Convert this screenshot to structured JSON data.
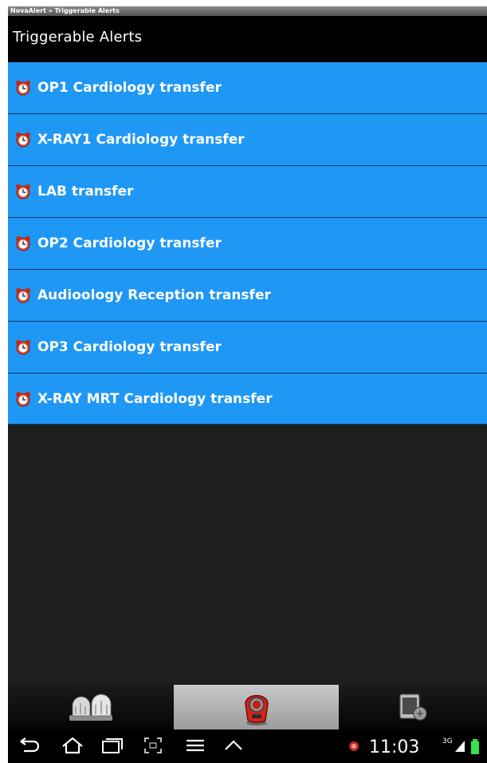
{
  "header": {
    "breadcrumb": "NovaAlert » Triggerable Alerts",
    "title": "Triggerable Alerts"
  },
  "alerts": [
    {
      "label": "OP1 Cardiology transfer",
      "icon": "alarm-clock-icon"
    },
    {
      "label": "X-RAY1 Cardiology transfer",
      "icon": "alarm-clock-icon"
    },
    {
      "label": "LAB transfer",
      "icon": "alarm-clock-icon"
    },
    {
      "label": "OP2 Cardiology transfer",
      "icon": "alarm-clock-icon"
    },
    {
      "label": "Audioology Reception transfer",
      "icon": "alarm-clock-icon"
    },
    {
      "label": "OP3 Cardiology transfer",
      "icon": "alarm-clock-icon"
    },
    {
      "label": "X-RAY MRT Cardiology transfer",
      "icon": "alarm-clock-icon"
    }
  ],
  "tabs": [
    {
      "icon": "siren-lights-icon",
      "selected": false
    },
    {
      "icon": "alarm-button-icon",
      "selected": true
    },
    {
      "icon": "device-status-icon",
      "selected": false
    }
  ],
  "status_bar": {
    "time": "11:03",
    "network": "3G",
    "icons": [
      "back-icon",
      "home-icon",
      "recent-apps-icon",
      "screenshot-icon",
      "menu-icon",
      "chevron-up-icon",
      "notification-icon",
      "signal-icon",
      "battery-icon"
    ]
  },
  "colors": {
    "list_item": "#1f97f5",
    "background": "#1e1e1e",
    "title_bar": "#000000",
    "selected_tab": "#b5b5b5"
  }
}
